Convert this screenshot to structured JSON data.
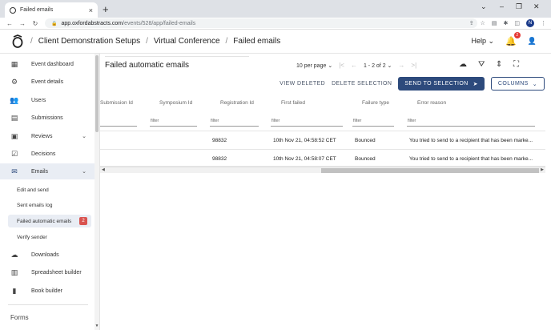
{
  "browser": {
    "tab_title": "Failed emails",
    "tab_close": "×",
    "new_tab": "+",
    "url_host": "app.oxfordabstracts.com",
    "url_path": "/events/528/app/failed-emails",
    "profile_initial": "N",
    "win_minimize": "–",
    "win_restore": "❐",
    "win_close": "✕",
    "dropdown": "⌄"
  },
  "header": {
    "crumbs": [
      "Client Demonstration Setups",
      "Virtual Conference",
      "Failed emails"
    ],
    "separator": "/",
    "help_label": "Help",
    "notifications_count": "2"
  },
  "sidebar": {
    "items": [
      {
        "label": "Event dashboard",
        "icon": "dashboard-icon"
      },
      {
        "label": "Event details",
        "icon": "gear-icon"
      },
      {
        "label": "Users",
        "icon": "users-icon"
      },
      {
        "label": "Submissions",
        "icon": "document-icon"
      },
      {
        "label": "Reviews",
        "icon": "clipboard-icon"
      },
      {
        "label": "Decisions",
        "icon": "checkbox-icon"
      },
      {
        "label": "Emails",
        "icon": "mail-icon"
      }
    ],
    "email_subitems": [
      {
        "label": "Edit and send"
      },
      {
        "label": "Sent emails log"
      },
      {
        "label": "Failed automatic emails",
        "badge": "2"
      },
      {
        "label": "Verify sender"
      }
    ],
    "more_items": [
      {
        "label": "Downloads",
        "icon": "cloud-download-icon"
      },
      {
        "label": "Spreadsheet builder",
        "icon": "table-icon"
      },
      {
        "label": "Book builder",
        "icon": "book-icon"
      }
    ],
    "section_label": "Forms"
  },
  "main": {
    "title": "Failed automatic emails",
    "per_page": "10 per page",
    "page_range": "1 - 2 of 2",
    "actions": {
      "view_deleted": "VIEW DELETED",
      "delete_selection": "DELETE SELECTION",
      "send_to_selection": "SEND TO SELECTION",
      "columns": "COLUMNS"
    },
    "columns": [
      "Submission Id",
      "Symposium Id",
      "Registration Id",
      "First failed",
      "Failure type",
      "Error reason"
    ],
    "filter_placeholder": "filter",
    "rows": [
      {
        "submission_id": "",
        "symposium_id": "",
        "registration_id": "98832",
        "first_failed": "10th Nov 21, 04:58:52 CET",
        "failure_type": "Bounced",
        "error_reason": "You tried to send to a recipient that has been marke..."
      },
      {
        "submission_id": "",
        "symposium_id": "",
        "registration_id": "98832",
        "first_failed": "10th Nov 21, 04:58:07 CET",
        "failure_type": "Bounced",
        "error_reason": "You tried to send to a recipient that has been marke..."
      }
    ]
  },
  "colors": {
    "primary": "#2d4a7c",
    "badge_red": "#d9534f",
    "active_bg": "#e9edf4"
  }
}
